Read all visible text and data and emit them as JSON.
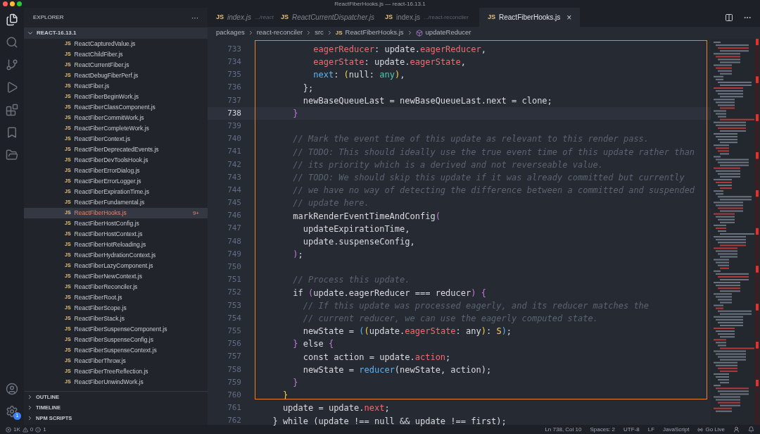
{
  "window": {
    "title": "ReactFiberHooks.js — react-16.13.1"
  },
  "activity_bar": {
    "settings_badge": "1"
  },
  "sidebar": {
    "title": "EXPLORER",
    "more": "···",
    "root": "REACT-16.13.1",
    "files": [
      {
        "icon": "JS",
        "name": "ReactCapturedValue.js",
        "selected": false
      },
      {
        "icon": "JS",
        "name": "ReactChildFiber.js",
        "selected": false
      },
      {
        "icon": "JS",
        "name": "ReactCurrentFiber.js",
        "selected": false
      },
      {
        "icon": "JS",
        "name": "ReactDebugFiberPerf.js",
        "selected": false
      },
      {
        "icon": "JS",
        "name": "ReactFiber.js",
        "selected": false
      },
      {
        "icon": "JS",
        "name": "ReactFiberBeginWork.js",
        "selected": false
      },
      {
        "icon": "JS",
        "name": "ReactFiberClassComponent.js",
        "selected": false
      },
      {
        "icon": "JS",
        "name": "ReactFiberCommitWork.js",
        "selected": false
      },
      {
        "icon": "JS",
        "name": "ReactFiberCompleteWork.js",
        "selected": false
      },
      {
        "icon": "JS",
        "name": "ReactFiberContext.js",
        "selected": false
      },
      {
        "icon": "JS",
        "name": "ReactFiberDeprecatedEvents.js",
        "selected": false
      },
      {
        "icon": "JS",
        "name": "ReactFiberDevToolsHook.js",
        "selected": false
      },
      {
        "icon": "JS",
        "name": "ReactFiberErrorDialog.js",
        "selected": false
      },
      {
        "icon": "JS",
        "name": "ReactFiberErrorLogger.js",
        "selected": false
      },
      {
        "icon": "JS",
        "name": "ReactFiberExpirationTime.js",
        "selected": false
      },
      {
        "icon": "JS",
        "name": "ReactFiberFundamental.js",
        "selected": false
      },
      {
        "icon": "JS",
        "name": "ReactFiberHooks.js",
        "selected": true,
        "badge": "9+"
      },
      {
        "icon": "JS",
        "name": "ReactFiberHostConfig.js",
        "selected": false
      },
      {
        "icon": "JS",
        "name": "ReactFiberHostContext.js",
        "selected": false
      },
      {
        "icon": "JS",
        "name": "ReactFiberHotReloading.js",
        "selected": false
      },
      {
        "icon": "JS",
        "name": "ReactFiberHydrationContext.js",
        "selected": false
      },
      {
        "icon": "JS",
        "name": "ReactFiberLazyComponent.js",
        "selected": false
      },
      {
        "icon": "JS",
        "name": "ReactFiberNewContext.js",
        "selected": false
      },
      {
        "icon": "JS",
        "name": "ReactFiberReconciler.js",
        "selected": false
      },
      {
        "icon": "JS",
        "name": "ReactFiberRoot.js",
        "selected": false
      },
      {
        "icon": "JS",
        "name": "ReactFiberScope.js",
        "selected": false
      },
      {
        "icon": "JS",
        "name": "ReactFiberStack.js",
        "selected": false
      },
      {
        "icon": "JS",
        "name": "ReactFiberSuspenseComponent.js",
        "selected": false
      },
      {
        "icon": "JS",
        "name": "ReactFiberSuspenseConfig.js",
        "selected": false
      },
      {
        "icon": "JS",
        "name": "ReactFiberSuspenseContext.js",
        "selected": false
      },
      {
        "icon": "JS",
        "name": "ReactFiberThrow.js",
        "selected": false
      },
      {
        "icon": "JS",
        "name": "ReactFiberTreeReflection.js",
        "selected": false
      },
      {
        "icon": "JS",
        "name": "ReactFiberUnwindWork.js",
        "selected": false
      }
    ],
    "sections": [
      "OUTLINE",
      "TIMELINE",
      "NPM SCRIPTS"
    ]
  },
  "tabs": [
    {
      "icon": "JS",
      "label": "index.js",
      "description": ".../react",
      "selected": false,
      "preview": true
    },
    {
      "icon": "JS",
      "label": "ReactCurrentDispatcher.js",
      "selected": false,
      "preview": true
    },
    {
      "icon": "JS",
      "label": "index.js",
      "description": ".../react-reconciler",
      "selected": false,
      "preview": false
    },
    {
      "icon": "JS",
      "label": "ReactFiberHooks.js",
      "selected": true,
      "preview": false,
      "close": "×"
    }
  ],
  "breadcrumbs": [
    {
      "kind": "folder",
      "label": "packages"
    },
    {
      "kind": "folder",
      "label": "react-reconciler"
    },
    {
      "kind": "folder",
      "label": "src"
    },
    {
      "kind": "file",
      "icon": "JS",
      "label": "ReactFiberHooks.js"
    },
    {
      "kind": "symbol",
      "label": "updateReducer"
    }
  ],
  "code": {
    "lines": [
      {
        "number": "733",
        "current": false,
        "tokens": [
          {
            "kind": "prop",
            "text": "          eagerReducer"
          },
          {
            "kind": "plain",
            "text": ": update."
          },
          {
            "kind": "prop",
            "text": "eagerReducer"
          },
          {
            "kind": "plain",
            "text": ","
          }
        ]
      },
      {
        "number": "734",
        "current": false,
        "tokens": [
          {
            "kind": "prop",
            "text": "          eagerState"
          },
          {
            "kind": "plain",
            "text": ": update."
          },
          {
            "kind": "prop",
            "text": "eagerState"
          },
          {
            "kind": "plain",
            "text": ","
          }
        ]
      },
      {
        "number": "735",
        "current": false,
        "tokens": [
          {
            "kind": "fn",
            "text": "          next"
          },
          {
            "kind": "plain",
            "text": ": "
          },
          {
            "kind": "paren",
            "text": "("
          },
          {
            "kind": "plain",
            "text": "null: "
          },
          {
            "kind": "type",
            "text": "any"
          },
          {
            "kind": "paren",
            "text": ")"
          },
          {
            "kind": "plain",
            "text": ","
          }
        ]
      },
      {
        "number": "736",
        "current": false,
        "tokens": [
          {
            "kind": "plain",
            "text": "        };"
          }
        ]
      },
      {
        "number": "737",
        "current": false,
        "tokens": [
          {
            "kind": "plain",
            "text": "        newBaseQueueLast = newBaseQueueLast.next = clone;"
          }
        ]
      },
      {
        "number": "738",
        "current": true,
        "tokens": [
          {
            "kind": "brace",
            "text": "      }"
          }
        ]
      },
      {
        "number": "739",
        "current": false
      },
      {
        "number": "740",
        "current": false,
        "tokens": [
          {
            "kind": "comment",
            "text": "      // Mark the event time of this update as relevant to this render pass."
          }
        ]
      },
      {
        "number": "741",
        "current": false,
        "tokens": [
          {
            "kind": "comment",
            "text": "      // TODO: This should ideally use the true event time of this update rather than"
          }
        ]
      },
      {
        "number": "742",
        "current": false,
        "tokens": [
          {
            "kind": "comment",
            "text": "      // its priority which is a derived and not reverseable value."
          }
        ]
      },
      {
        "number": "743",
        "current": false,
        "tokens": [
          {
            "kind": "comment",
            "text": "      // TODO: We should skip this update if it was already committed but currently"
          }
        ]
      },
      {
        "number": "744",
        "current": false,
        "tokens": [
          {
            "kind": "comment",
            "text": "      // we have no way of detecting the difference between a committed and suspended"
          }
        ]
      },
      {
        "number": "745",
        "current": false,
        "tokens": [
          {
            "kind": "comment",
            "text": "      // update here."
          }
        ]
      },
      {
        "number": "746",
        "current": false,
        "tokens": [
          {
            "kind": "plain",
            "text": "      markRenderEventTimeAndConfig"
          },
          {
            "kind": "brace",
            "text": "("
          }
        ]
      },
      {
        "number": "747",
        "current": false,
        "tokens": [
          {
            "kind": "plain",
            "text": "        updateExpirationTime,"
          }
        ]
      },
      {
        "number": "748",
        "current": false,
        "tokens": [
          {
            "kind": "plain",
            "text": "        update.suspenseConfig,"
          }
        ]
      },
      {
        "number": "749",
        "current": false,
        "tokens": [
          {
            "kind": "brace",
            "text": "      )"
          },
          {
            "kind": "plain",
            "text": ";"
          }
        ]
      },
      {
        "number": "750",
        "current": false
      },
      {
        "number": "751",
        "current": false,
        "tokens": [
          {
            "kind": "comment",
            "text": "      // Process this update."
          }
        ]
      },
      {
        "number": "752",
        "current": false,
        "tokens": [
          {
            "kind": "plain",
            "text": "      if "
          },
          {
            "kind": "brace",
            "text": "("
          },
          {
            "kind": "plain",
            "text": "update.eagerReducer === reducer"
          },
          {
            "kind": "brace",
            "text": ") {"
          }
        ]
      },
      {
        "number": "753",
        "current": false,
        "tokens": [
          {
            "kind": "comment",
            "text": "        // If this update was processed eagerly, and its reducer matches the"
          }
        ]
      },
      {
        "number": "754",
        "current": false,
        "tokens": [
          {
            "kind": "comment",
            "text": "        // current reducer, we can use the eagerly computed state."
          }
        ]
      },
      {
        "number": "755",
        "current": false,
        "tokens": [
          {
            "kind": "plain",
            "text": "        newState = "
          },
          {
            "kind": "fn",
            "text": "("
          },
          {
            "kind": "paren",
            "text": "("
          },
          {
            "kind": "plain",
            "text": "update."
          },
          {
            "kind": "prop",
            "text": "eagerState"
          },
          {
            "kind": "plain",
            "text": ": any"
          },
          {
            "kind": "paren",
            "text": ")"
          },
          {
            "kind": "plain",
            "text": ": "
          },
          {
            "kind": "paren",
            "text": "S"
          },
          {
            "kind": "fn",
            "text": ")"
          },
          {
            "kind": "plain",
            "text": ";"
          }
        ]
      },
      {
        "number": "756",
        "current": false,
        "tokens": [
          {
            "kind": "brace",
            "text": "      }"
          },
          {
            "kind": "plain",
            "text": " else "
          },
          {
            "kind": "brace",
            "text": "{"
          }
        ]
      },
      {
        "number": "757",
        "current": false,
        "tokens": [
          {
            "kind": "plain",
            "text": "        const action = update."
          },
          {
            "kind": "prop",
            "text": "action"
          },
          {
            "kind": "plain",
            "text": ";"
          }
        ]
      },
      {
        "number": "758",
        "current": false,
        "tokens": [
          {
            "kind": "plain",
            "text": "        newState = "
          },
          {
            "kind": "fn",
            "text": "reducer"
          },
          {
            "kind": "plain",
            "text": "(newState, action);"
          }
        ]
      },
      {
        "number": "759",
        "current": false,
        "tokens": [
          {
            "kind": "brace",
            "text": "      }"
          }
        ]
      },
      {
        "number": "760",
        "current": false,
        "tokens": [
          {
            "kind": "paren",
            "text": "    }"
          }
        ]
      },
      {
        "number": "761",
        "current": false,
        "tokens": [
          {
            "kind": "plain",
            "text": "    update = update."
          },
          {
            "kind": "prop",
            "text": "next"
          },
          {
            "kind": "plain",
            "text": ";"
          }
        ]
      },
      {
        "number": "762",
        "current": false,
        "tokens": [
          {
            "kind": "plain",
            "text": "  } while (update !== null && update !== first);"
          }
        ]
      }
    ]
  },
  "status_bar": {
    "errors": "1K",
    "warnings": "0",
    "infos": "1",
    "items": [
      "Ln 738, Col 10",
      "Spaces: 2",
      "UTF-8",
      "LF",
      "JavaScript"
    ],
    "go_live": "Go Live"
  }
}
